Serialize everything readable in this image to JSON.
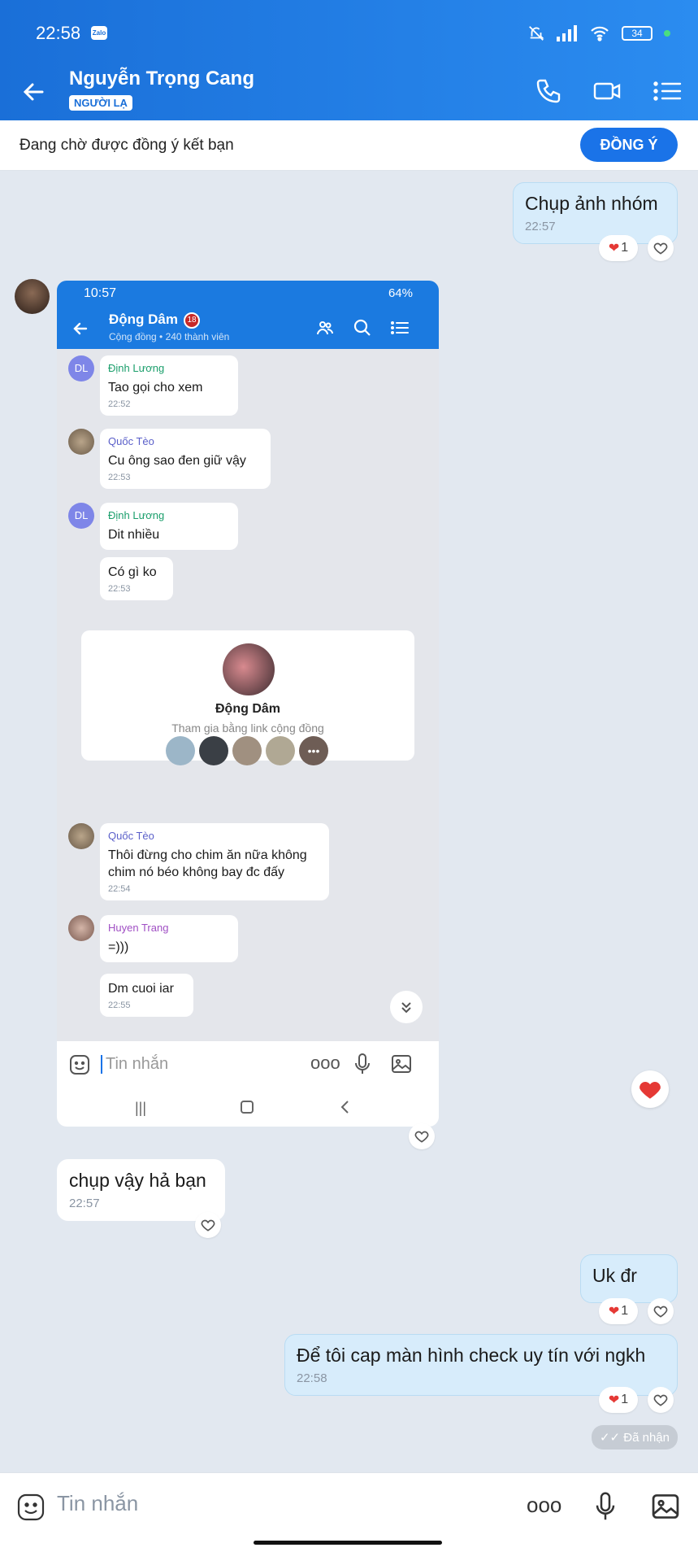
{
  "status_bar": {
    "time": "22:58",
    "app_badge": "Zalo",
    "battery": "34"
  },
  "header": {
    "title": "Nguyễn Trọng Cang",
    "badge": "NGƯỜI LẠ"
  },
  "friend_request": {
    "text": "Đang chờ được đồng ý kết bạn",
    "accept_label": "ĐỒNG Ý"
  },
  "messages": [
    {
      "text": "Chụp ảnh nhóm",
      "time": "22:57",
      "reactions": "1"
    },
    {
      "text": "chụp vậy hả bạn",
      "time": "22:57"
    },
    {
      "text": "Uk đr",
      "reactions": "1"
    },
    {
      "text": "Để tôi cap màn hình check uy tín với ngkh",
      "time": "22:58",
      "reactions": "1"
    }
  ],
  "delivery_status": "Đã nhận",
  "composer": {
    "placeholder": "Tin nhắn"
  },
  "screenshot": {
    "status_time": "10:57",
    "battery": "64%",
    "group_name": "Động Dâm",
    "group_sub": "Cộng đồng • 240 thành viên",
    "messages": [
      {
        "sender": "Định Lương",
        "text": "Tao gọi cho xem",
        "time": "22:52"
      },
      {
        "sender": "Quốc Tèo",
        "text": "Cu ông sao đen giữ vậy",
        "time": "22:53"
      },
      {
        "sender": "Định Lương",
        "text": "Dit nhiều"
      },
      {
        "text": "Có gì ko",
        "time": "22:53"
      },
      {
        "sender": "Quốc Tèo",
        "text": "Thôi đừng cho chim ăn nữa không chim nó béo không bay đc đấy",
        "time": "22:54"
      },
      {
        "sender": "Huyen Trang",
        "text": "=)))"
      },
      {
        "text": "Dm cuoi iar",
        "time": "22:55"
      }
    ],
    "avatar_initials": "DL",
    "card": {
      "name": "Động Dâm",
      "desc": "Tham gia bằng link cộng đồng"
    },
    "input_placeholder": "Tin nhắn"
  },
  "colors": {
    "brand": "#1a73e8",
    "own_bubble": "#d7ecfb",
    "background": "#e2e8f0"
  }
}
